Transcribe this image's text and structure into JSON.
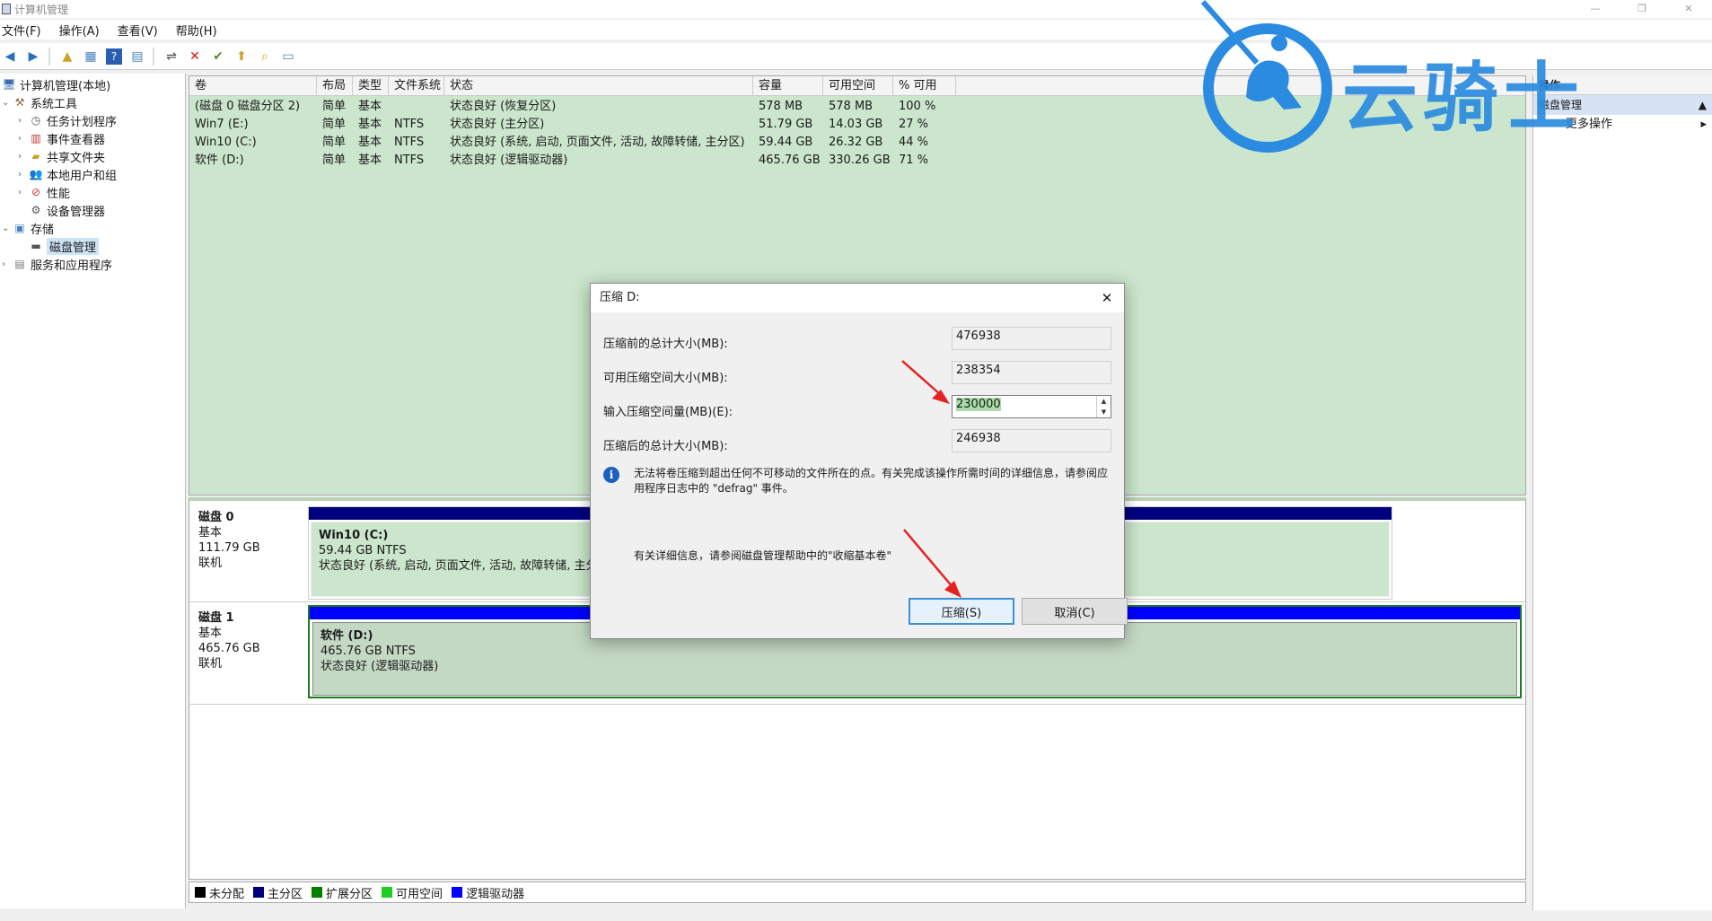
{
  "window": {
    "title": "计算机管理",
    "min": "—",
    "restore": "❐",
    "close": "✕"
  },
  "menu": [
    "文件(F)",
    "操作(A)",
    "查看(V)",
    "帮助(H)"
  ],
  "tree": {
    "root": "计算机管理(本地)",
    "system_tools": "系统工具",
    "task_scheduler": "任务计划程序",
    "event_viewer": "事件查看器",
    "shared_folders": "共享文件夹",
    "local_users": "本地用户和组",
    "performance": "性能",
    "device_manager": "设备管理器",
    "storage": "存储",
    "disk_management": "磁盘管理",
    "services_apps": "服务和应用程序"
  },
  "volume_table": {
    "headers": [
      "卷",
      "布局",
      "类型",
      "文件系统",
      "状态",
      "容量",
      "可用空间",
      "% 可用"
    ],
    "rows": [
      [
        "(磁盘 0 磁盘分区 2)",
        "简单",
        "基本",
        "",
        "状态良好 (恢复分区)",
        "578 MB",
        "578 MB",
        "100 %"
      ],
      [
        "Win7 (E:)",
        "简单",
        "基本",
        "NTFS",
        "状态良好 (主分区)",
        "51.79 GB",
        "14.03 GB",
        "27 %"
      ],
      [
        "Win10 (C:)",
        "简单",
        "基本",
        "NTFS",
        "状态良好 (系统, 启动, 页面文件, 活动, 故障转储, 主分区)",
        "59.44 GB",
        "26.32 GB",
        "44 %"
      ],
      [
        "软件 (D:)",
        "简单",
        "基本",
        "NTFS",
        "状态良好 (逻辑驱动器)",
        "465.76 GB",
        "330.26 GB",
        "71 %"
      ]
    ]
  },
  "disks": [
    {
      "name": "磁盘 0",
      "type": "基本",
      "size": "111.79 GB",
      "status": "联机",
      "partition": {
        "name": "Win10 (C:)",
        "size_fs": "59.44 GB NTFS",
        "status": "状态良好 (系统, 启动, 页面文件, 活动, 故障转储, 主分"
      }
    },
    {
      "name": "磁盘 1",
      "type": "基本",
      "size": "465.76 GB",
      "status": "联机",
      "partition": {
        "name": "软件 (D:)",
        "size_fs": "465.76 GB NTFS",
        "status": "状态良好 (逻辑驱动器)"
      }
    }
  ],
  "legend": [
    {
      "label": "未分配",
      "color": "#000000"
    },
    {
      "label": "主分区",
      "color": "#00007f"
    },
    {
      "label": "扩展分区",
      "color": "#007f00"
    },
    {
      "label": "可用空间",
      "color": "#22cc22"
    },
    {
      "label": "逻辑驱动器",
      "color": "#0000ff"
    }
  ],
  "actions": {
    "header": "操作",
    "section": "磁盘管理",
    "more": "更多操作"
  },
  "dialog": {
    "title": "压缩 D:",
    "total_before_label": "压缩前的总计大小(MB):",
    "total_before_value": "476938",
    "available_label": "可用压缩空间大小(MB):",
    "available_value": "238354",
    "input_label": "输入压缩空间量(MB)(E):",
    "input_value": "230000",
    "total_after_label": "压缩后的总计大小(MB):",
    "total_after_value": "246938",
    "info_text": "无法将卷压缩到超出任何不可移动的文件所在的点。有关完成该操作所需时间的详细信息，请参阅应用程序日志中的 \"defrag\" 事件。",
    "more_info": "有关详细信息，请参阅磁盘管理帮助中的\"收缩基本卷\"",
    "shrink_button": "压缩(S)",
    "cancel_button": "取消(C)"
  },
  "watermark": {
    "text": "云骑士"
  },
  "colors": {
    "primary_partition": "#00007f",
    "logical_drive": "#0000ff",
    "table_bg": "#cbe6cc",
    "watermark": "#2b8be0",
    "annotation": "#e52222"
  }
}
